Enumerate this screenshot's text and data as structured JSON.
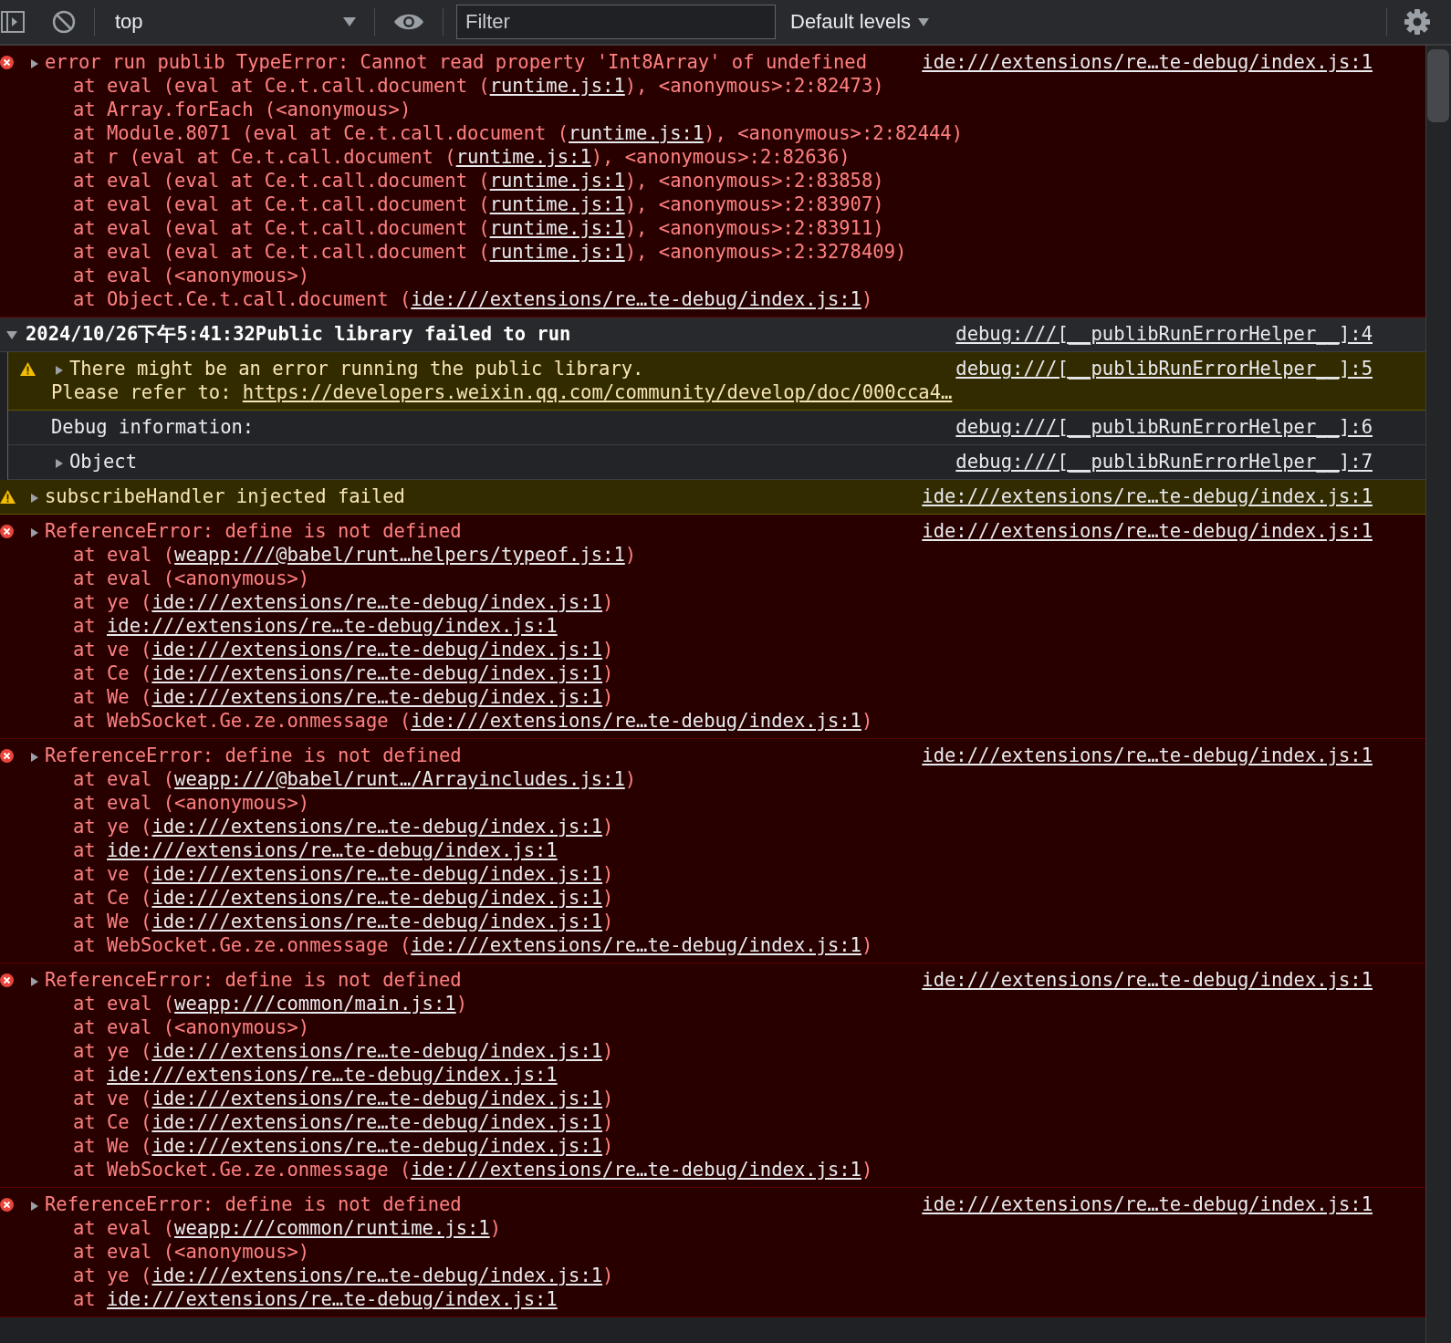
{
  "toolbar": {
    "context": "top",
    "filter": {
      "placeholder": "Filter"
    },
    "levels": "Default levels"
  },
  "messages": [
    {
      "kind": "error",
      "expanded": false,
      "text": "error run publib TypeError: Cannot read property 'Int8Array' of undefined",
      "source": "ide:///extensions/re…te-debug/index.js:1",
      "stack": [
        {
          "pre": "at eval (eval at Ce.t.call.document (",
          "link": "runtime.js:1",
          "post": "), <anonymous>:2:82473)"
        },
        {
          "pre": "at Array.forEach (<anonymous>)"
        },
        {
          "pre": "at Module.8071 (eval at Ce.t.call.document (",
          "link": "runtime.js:1",
          "post": "), <anonymous>:2:82444)"
        },
        {
          "pre": "at r (eval at Ce.t.call.document (",
          "link": "runtime.js:1",
          "post": "), <anonymous>:2:82636)"
        },
        {
          "pre": "at eval (eval at Ce.t.call.document (",
          "link": "runtime.js:1",
          "post": "), <anonymous>:2:83858)"
        },
        {
          "pre": "at eval (eval at Ce.t.call.document (",
          "link": "runtime.js:1",
          "post": "), <anonymous>:2:83907)"
        },
        {
          "pre": "at eval (eval at Ce.t.call.document (",
          "link": "runtime.js:1",
          "post": "), <anonymous>:2:83911)"
        },
        {
          "pre": "at eval (eval at Ce.t.call.document (",
          "link": "runtime.js:1",
          "post": "), <anonymous>:2:3278409)"
        },
        {
          "pre": "at eval (<anonymous>)"
        },
        {
          "pre": "at Object.Ce.t.call.document (",
          "link": "ide:///extensions/re…te-debug/index.js:1",
          "post": ")"
        }
      ]
    },
    {
      "kind": "group",
      "expanded": true,
      "text": "2024/10/26下午5:41:32Public library failed to run",
      "source": "debug:///[__publibRunErrorHelper__]:4",
      "children": [
        {
          "kind": "warning",
          "expanded": false,
          "text": "There might be an error running the public library.",
          "source": "debug:///[__publibRunErrorHelper__]:5",
          "lines": [
            {
              "pre": "Please refer to: ",
              "link": "https://developers.weixin.qq.com/community/develop/doc/000cca4…"
            }
          ]
        },
        {
          "kind": "info",
          "text": "Debug information:",
          "source": "debug:///[__publibRunErrorHelper__]:6"
        },
        {
          "kind": "info",
          "expanded": false,
          "text": "Object",
          "source": "debug:///[__publibRunErrorHelper__]:7"
        }
      ]
    },
    {
      "kind": "warning",
      "expanded": false,
      "text": "subscribeHandler injected failed",
      "source": "ide:///extensions/re…te-debug/index.js:1"
    },
    {
      "kind": "error",
      "expanded": false,
      "text": "ReferenceError: define is not defined",
      "source": "ide:///extensions/re…te-debug/index.js:1",
      "stack": [
        {
          "pre": "at eval (",
          "link": "weapp:///@babel/runt…helpers/typeof.js:1",
          "post": ")"
        },
        {
          "pre": "at eval (<anonymous>)"
        },
        {
          "pre": "at ye (",
          "link": "ide:///extensions/re…te-debug/index.js:1",
          "post": ")"
        },
        {
          "pre": "at ",
          "link": "ide:///extensions/re…te-debug/index.js:1"
        },
        {
          "pre": "at ve (",
          "link": "ide:///extensions/re…te-debug/index.js:1",
          "post": ")"
        },
        {
          "pre": "at Ce (",
          "link": "ide:///extensions/re…te-debug/index.js:1",
          "post": ")"
        },
        {
          "pre": "at We (",
          "link": "ide:///extensions/re…te-debug/index.js:1",
          "post": ")"
        },
        {
          "pre": "at WebSocket.Ge.ze.onmessage (",
          "link": "ide:///extensions/re…te-debug/index.js:1",
          "post": ")"
        }
      ]
    },
    {
      "kind": "error",
      "expanded": false,
      "text": "ReferenceError: define is not defined",
      "source": "ide:///extensions/re…te-debug/index.js:1",
      "stack": [
        {
          "pre": "at eval (",
          "link": "weapp:///@babel/runt…/Arrayincludes.js:1",
          "post": ")"
        },
        {
          "pre": "at eval (<anonymous>)"
        },
        {
          "pre": "at ye (",
          "link": "ide:///extensions/re…te-debug/index.js:1",
          "post": ")"
        },
        {
          "pre": "at ",
          "link": "ide:///extensions/re…te-debug/index.js:1"
        },
        {
          "pre": "at ve (",
          "link": "ide:///extensions/re…te-debug/index.js:1",
          "post": ")"
        },
        {
          "pre": "at Ce (",
          "link": "ide:///extensions/re…te-debug/index.js:1",
          "post": ")"
        },
        {
          "pre": "at We (",
          "link": "ide:///extensions/re…te-debug/index.js:1",
          "post": ")"
        },
        {
          "pre": "at WebSocket.Ge.ze.onmessage (",
          "link": "ide:///extensions/re…te-debug/index.js:1",
          "post": ")"
        }
      ]
    },
    {
      "kind": "error",
      "expanded": false,
      "text": "ReferenceError: define is not defined",
      "source": "ide:///extensions/re…te-debug/index.js:1",
      "stack": [
        {
          "pre": "at eval (",
          "link": "weapp:///common/main.js:1",
          "post": ")"
        },
        {
          "pre": "at eval (<anonymous>)"
        },
        {
          "pre": "at ye (",
          "link": "ide:///extensions/re…te-debug/index.js:1",
          "post": ")"
        },
        {
          "pre": "at ",
          "link": "ide:///extensions/re…te-debug/index.js:1"
        },
        {
          "pre": "at ve (",
          "link": "ide:///extensions/re…te-debug/index.js:1",
          "post": ")"
        },
        {
          "pre": "at Ce (",
          "link": "ide:///extensions/re…te-debug/index.js:1",
          "post": ")"
        },
        {
          "pre": "at We (",
          "link": "ide:///extensions/re…te-debug/index.js:1",
          "post": ")"
        },
        {
          "pre": "at WebSocket.Ge.ze.onmessage (",
          "link": "ide:///extensions/re…te-debug/index.js:1",
          "post": ")"
        }
      ]
    },
    {
      "kind": "error",
      "expanded": false,
      "text": "ReferenceError: define is not defined",
      "source": "ide:///extensions/re…te-debug/index.js:1",
      "stack": [
        {
          "pre": "at eval (",
          "link": "weapp:///common/runtime.js:1",
          "post": ")"
        },
        {
          "pre": "at eval (<anonymous>)"
        },
        {
          "pre": "at ye (",
          "link": "ide:///extensions/re…te-debug/index.js:1",
          "post": ")"
        },
        {
          "pre": "at ",
          "link": "ide:///extensions/re…te-debug/index.js:1"
        }
      ]
    }
  ]
}
